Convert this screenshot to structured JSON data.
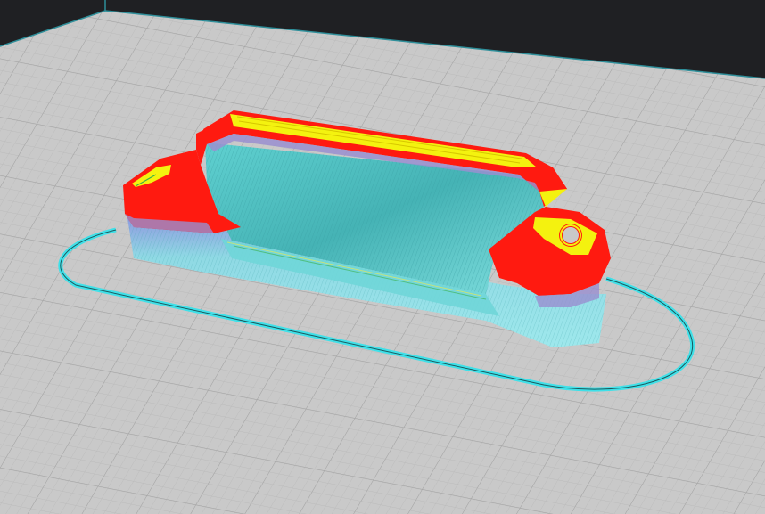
{
  "viewer": {
    "view": "layer-preview",
    "object": "sliced-part"
  },
  "colors": {
    "background": "#1f2023",
    "bed": "#c9c9c9",
    "bed_border": "#2f8f9a",
    "grid_minor": "#bdbdbd",
    "grid_major": "#a8a8a8",
    "skirt": "#3fe0e8",
    "skirt_dark": "#1a5a5e",
    "perimeter": "#ff1a10",
    "top_solid_infill": "#f4f20f",
    "infill": "#58c8c8",
    "support": "#8fe3e8",
    "overhang": "#9a8fd0"
  },
  "icons": {
    "bed": "build-plate",
    "model": "toolpath-preview"
  }
}
